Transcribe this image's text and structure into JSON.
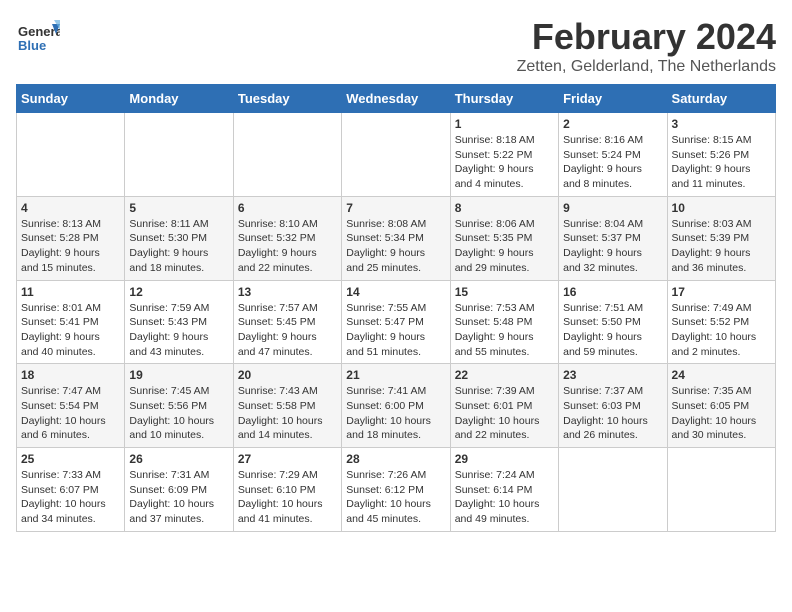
{
  "logo": {
    "general": "General",
    "blue": "Blue"
  },
  "title": "February 2024",
  "subtitle": "Zetten, Gelderland, The Netherlands",
  "days_of_week": [
    "Sunday",
    "Monday",
    "Tuesday",
    "Wednesday",
    "Thursday",
    "Friday",
    "Saturday"
  ],
  "weeks": [
    [
      {
        "day": "",
        "info": ""
      },
      {
        "day": "",
        "info": ""
      },
      {
        "day": "",
        "info": ""
      },
      {
        "day": "",
        "info": ""
      },
      {
        "day": "1",
        "info": "Sunrise: 8:18 AM\nSunset: 5:22 PM\nDaylight: 9 hours\nand 4 minutes."
      },
      {
        "day": "2",
        "info": "Sunrise: 8:16 AM\nSunset: 5:24 PM\nDaylight: 9 hours\nand 8 minutes."
      },
      {
        "day": "3",
        "info": "Sunrise: 8:15 AM\nSunset: 5:26 PM\nDaylight: 9 hours\nand 11 minutes."
      }
    ],
    [
      {
        "day": "4",
        "info": "Sunrise: 8:13 AM\nSunset: 5:28 PM\nDaylight: 9 hours\nand 15 minutes."
      },
      {
        "day": "5",
        "info": "Sunrise: 8:11 AM\nSunset: 5:30 PM\nDaylight: 9 hours\nand 18 minutes."
      },
      {
        "day": "6",
        "info": "Sunrise: 8:10 AM\nSunset: 5:32 PM\nDaylight: 9 hours\nand 22 minutes."
      },
      {
        "day": "7",
        "info": "Sunrise: 8:08 AM\nSunset: 5:34 PM\nDaylight: 9 hours\nand 25 minutes."
      },
      {
        "day": "8",
        "info": "Sunrise: 8:06 AM\nSunset: 5:35 PM\nDaylight: 9 hours\nand 29 minutes."
      },
      {
        "day": "9",
        "info": "Sunrise: 8:04 AM\nSunset: 5:37 PM\nDaylight: 9 hours\nand 32 minutes."
      },
      {
        "day": "10",
        "info": "Sunrise: 8:03 AM\nSunset: 5:39 PM\nDaylight: 9 hours\nand 36 minutes."
      }
    ],
    [
      {
        "day": "11",
        "info": "Sunrise: 8:01 AM\nSunset: 5:41 PM\nDaylight: 9 hours\nand 40 minutes."
      },
      {
        "day": "12",
        "info": "Sunrise: 7:59 AM\nSunset: 5:43 PM\nDaylight: 9 hours\nand 43 minutes."
      },
      {
        "day": "13",
        "info": "Sunrise: 7:57 AM\nSunset: 5:45 PM\nDaylight: 9 hours\nand 47 minutes."
      },
      {
        "day": "14",
        "info": "Sunrise: 7:55 AM\nSunset: 5:47 PM\nDaylight: 9 hours\nand 51 minutes."
      },
      {
        "day": "15",
        "info": "Sunrise: 7:53 AM\nSunset: 5:48 PM\nDaylight: 9 hours\nand 55 minutes."
      },
      {
        "day": "16",
        "info": "Sunrise: 7:51 AM\nSunset: 5:50 PM\nDaylight: 9 hours\nand 59 minutes."
      },
      {
        "day": "17",
        "info": "Sunrise: 7:49 AM\nSunset: 5:52 PM\nDaylight: 10 hours\nand 2 minutes."
      }
    ],
    [
      {
        "day": "18",
        "info": "Sunrise: 7:47 AM\nSunset: 5:54 PM\nDaylight: 10 hours\nand 6 minutes."
      },
      {
        "day": "19",
        "info": "Sunrise: 7:45 AM\nSunset: 5:56 PM\nDaylight: 10 hours\nand 10 minutes."
      },
      {
        "day": "20",
        "info": "Sunrise: 7:43 AM\nSunset: 5:58 PM\nDaylight: 10 hours\nand 14 minutes."
      },
      {
        "day": "21",
        "info": "Sunrise: 7:41 AM\nSunset: 6:00 PM\nDaylight: 10 hours\nand 18 minutes."
      },
      {
        "day": "22",
        "info": "Sunrise: 7:39 AM\nSunset: 6:01 PM\nDaylight: 10 hours\nand 22 minutes."
      },
      {
        "day": "23",
        "info": "Sunrise: 7:37 AM\nSunset: 6:03 PM\nDaylight: 10 hours\nand 26 minutes."
      },
      {
        "day": "24",
        "info": "Sunrise: 7:35 AM\nSunset: 6:05 PM\nDaylight: 10 hours\nand 30 minutes."
      }
    ],
    [
      {
        "day": "25",
        "info": "Sunrise: 7:33 AM\nSunset: 6:07 PM\nDaylight: 10 hours\nand 34 minutes."
      },
      {
        "day": "26",
        "info": "Sunrise: 7:31 AM\nSunset: 6:09 PM\nDaylight: 10 hours\nand 37 minutes."
      },
      {
        "day": "27",
        "info": "Sunrise: 7:29 AM\nSunset: 6:10 PM\nDaylight: 10 hours\nand 41 minutes."
      },
      {
        "day": "28",
        "info": "Sunrise: 7:26 AM\nSunset: 6:12 PM\nDaylight: 10 hours\nand 45 minutes."
      },
      {
        "day": "29",
        "info": "Sunrise: 7:24 AM\nSunset: 6:14 PM\nDaylight: 10 hours\nand 49 minutes."
      },
      {
        "day": "",
        "info": ""
      },
      {
        "day": "",
        "info": ""
      }
    ]
  ]
}
